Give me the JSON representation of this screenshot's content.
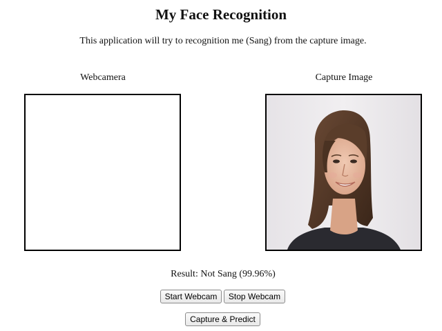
{
  "header": {
    "title": "My Face Recognition",
    "description": "This application will try to recognition me (Sang) from the capture image."
  },
  "webcam": {
    "label": "Webcamera"
  },
  "capture": {
    "label": "Capture Image"
  },
  "result": {
    "text": "Result: Not Sang (99.96%)"
  },
  "controls": {
    "start_label": "Start Webcam",
    "stop_label": "Stop Webcam",
    "capture_label": "Capture & Predict"
  }
}
